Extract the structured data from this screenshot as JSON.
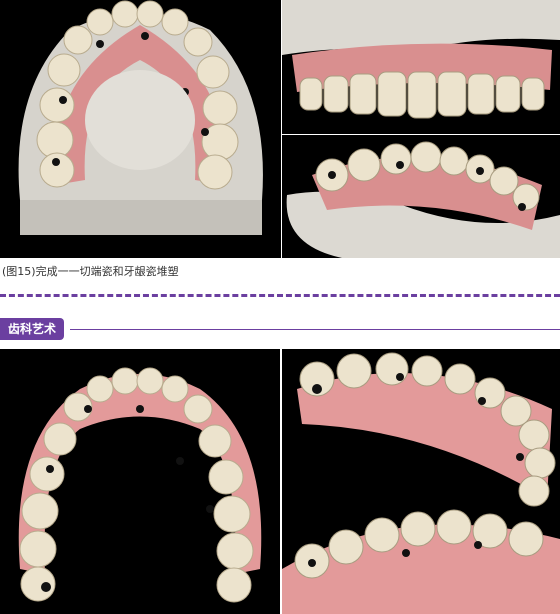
{
  "caption": "(图15)完成一一切端瓷和牙龈瓷堆塑",
  "section": {
    "badge_label": "齿科艺术"
  },
  "colors": {
    "accent": "#6b3fa0",
    "background_dark": "#000000",
    "plaster": "#d9d6cf",
    "gingiva": "#d98f8f",
    "tooth": "#ece3cd"
  }
}
